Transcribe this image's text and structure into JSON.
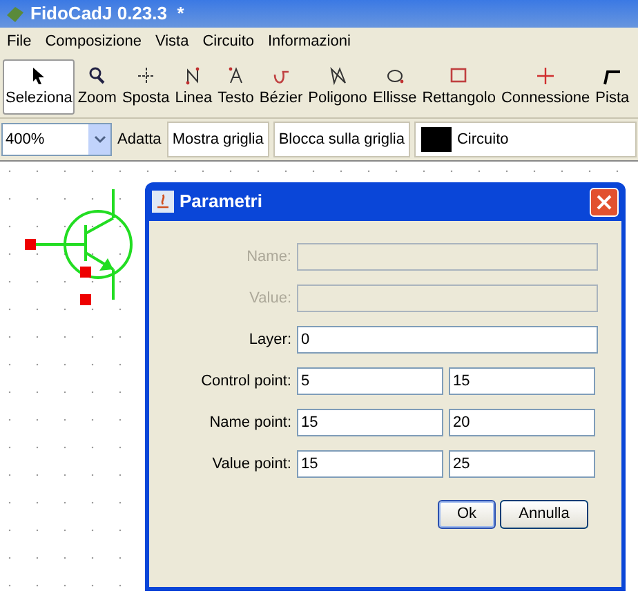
{
  "window": {
    "title": "FidoCadJ 0.23.3  *"
  },
  "menu": [
    "File",
    "Composizione",
    "Vista",
    "Circuito",
    "Informazioni"
  ],
  "tools": [
    {
      "label": "Seleziona",
      "selected": true
    },
    {
      "label": "Zoom",
      "selected": false
    },
    {
      "label": "Sposta",
      "selected": false
    },
    {
      "label": "Linea",
      "selected": false
    },
    {
      "label": "Testo",
      "selected": false
    },
    {
      "label": "Bézier",
      "selected": false
    },
    {
      "label": "Poligono",
      "selected": false
    },
    {
      "label": "Ellisse",
      "selected": false
    },
    {
      "label": "Rettangolo",
      "selected": false
    },
    {
      "label": "Connessione",
      "selected": false
    },
    {
      "label": "Pista",
      "selected": false
    }
  ],
  "zoom": {
    "value": "400%"
  },
  "fit_button": "Adatta",
  "toggles": [
    {
      "label": "Mostra griglia",
      "selected": true
    },
    {
      "label": "Blocca sulla griglia",
      "selected": true
    }
  ],
  "layer": {
    "label": "Circuito",
    "color": "#000000"
  },
  "dialog": {
    "title": "Parametri",
    "rows": [
      {
        "kind": "single",
        "label": "Name:",
        "disabled": true
      },
      {
        "kind": "single",
        "label": "Value:",
        "disabled": true
      },
      {
        "kind": "single",
        "label": "Layer:",
        "disabled": false,
        "values": [
          "0"
        ]
      },
      {
        "kind": "pair",
        "label": "Control point:",
        "disabled": false,
        "values": [
          "5",
          "15"
        ]
      },
      {
        "kind": "pair",
        "label": "Name point:",
        "disabled": false,
        "values": [
          "15",
          "20"
        ]
      },
      {
        "kind": "pair",
        "label": "Value point:",
        "disabled": false,
        "values": [
          "15",
          "25"
        ]
      }
    ],
    "buttons": [
      {
        "label": "Ok",
        "kind": "default"
      },
      {
        "label": "Annulla",
        "kind": "normal"
      }
    ]
  }
}
